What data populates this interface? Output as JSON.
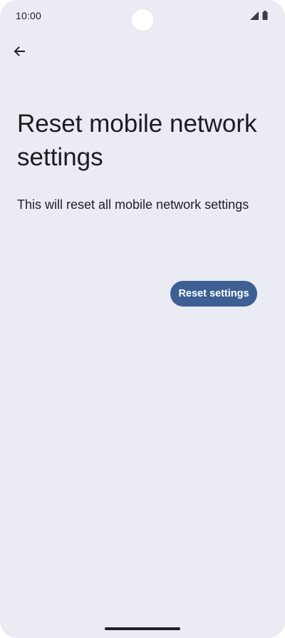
{
  "status_bar": {
    "time": "10:00",
    "icons": [
      "signal-icon",
      "battery-icon"
    ]
  },
  "toolbar": {
    "back_icon": "arrow-back-icon"
  },
  "page": {
    "title": "Reset mobile network settings",
    "description": "This will reset all mobile network settings"
  },
  "actions": {
    "reset_label": "Reset settings"
  },
  "colors": {
    "background": "#eaebf3",
    "accent": "#3d5f94",
    "text": "#1b1c20"
  }
}
